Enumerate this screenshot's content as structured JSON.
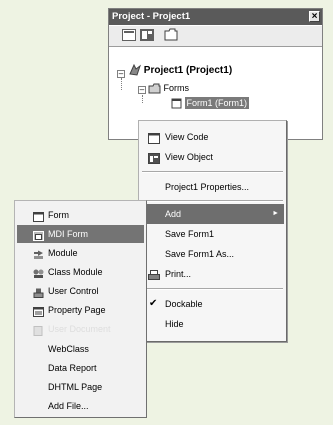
{
  "project_window": {
    "title": "Project - Project1",
    "toolbar": [
      {
        "icon": "view-code-icon"
      },
      {
        "icon": "view-object-icon"
      },
      {
        "icon": "toggle-folders-icon"
      }
    ],
    "tree": {
      "project_label": "Project1 (Project1)",
      "folder_label": "Forms",
      "form_label": "Form1 (Form1)"
    }
  },
  "context_menu": {
    "view_code": "View Code",
    "view_object": "View Object",
    "project_properties": "Project1 Properties...",
    "add": "Add",
    "save_form": "Save Form1",
    "save_form_as": "Save Form1 As...",
    "print": "Print...",
    "dockable": "Dockable",
    "hide": "Hide"
  },
  "add_submenu": {
    "form": "Form",
    "mdi_form": "MDI Form",
    "module": "Module",
    "class_module": "Class Module",
    "user_control": "User Control",
    "property_page": "Property Page",
    "user_document": "User Document",
    "webclass": "WebClass",
    "data_report": "Data Report",
    "dhtml_page": "DHTML Page",
    "add_file": "Add File..."
  },
  "colors": {
    "page_background": "#eef3e3",
    "highlight": "#6e6e6e",
    "title_bar": "#5a5a5a"
  }
}
